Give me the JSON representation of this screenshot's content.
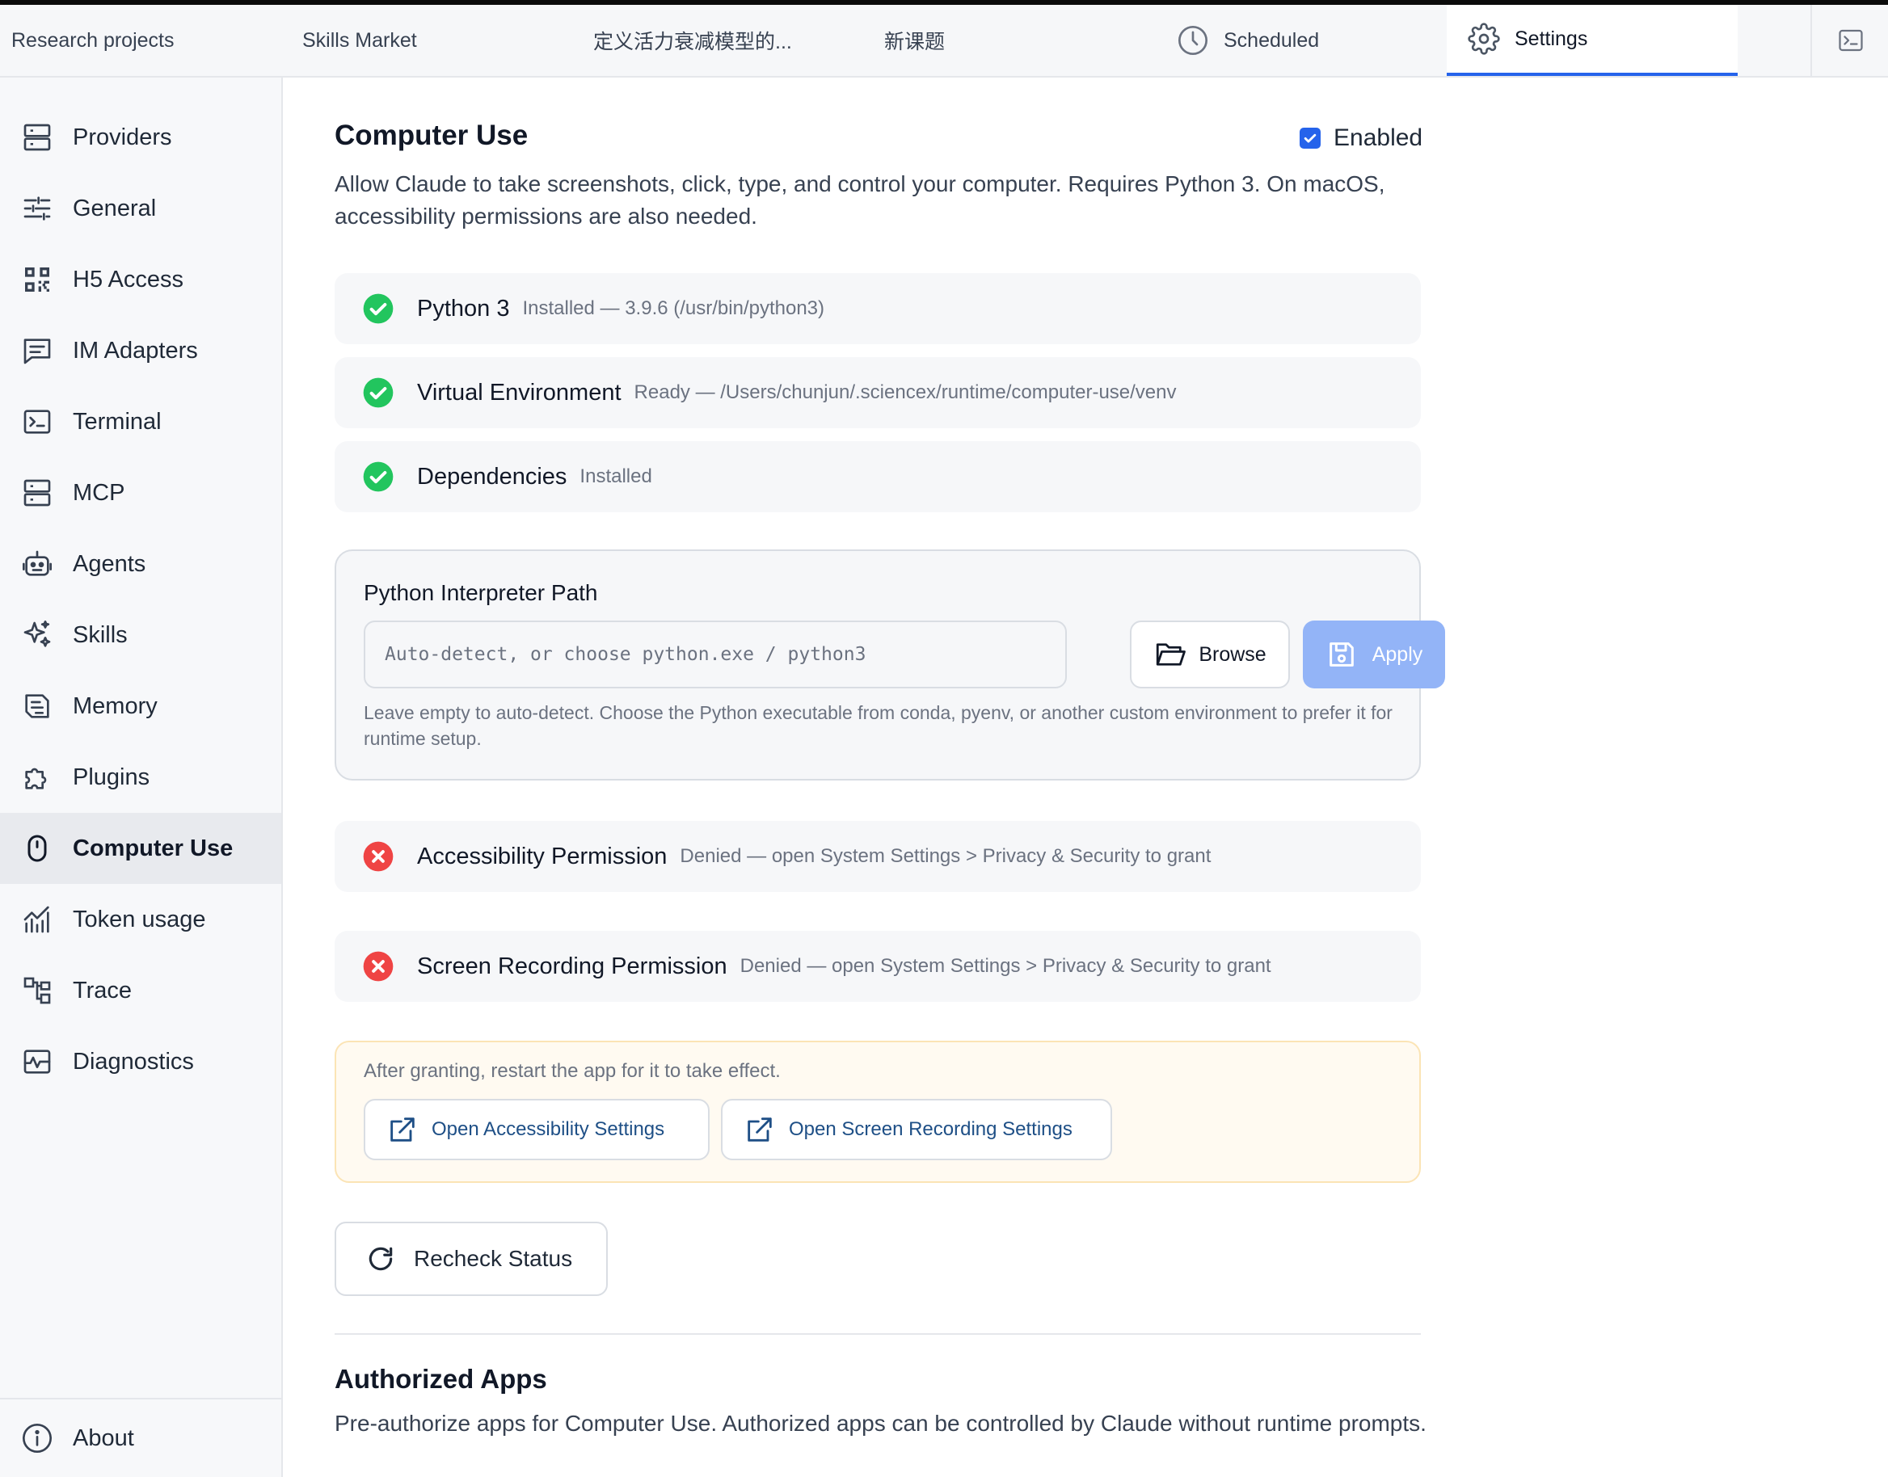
{
  "tabs": [
    {
      "label": "Research projects"
    },
    {
      "label": "Skills Market"
    },
    {
      "label": "定义活力衰减模型的..."
    },
    {
      "label": "新课题"
    },
    {
      "label": "Scheduled",
      "icon": "clock-icon"
    },
    {
      "label": "Settings",
      "icon": "gear-icon",
      "active": true
    }
  ],
  "sidebar": {
    "items": [
      {
        "label": "Providers",
        "icon": "server-icon"
      },
      {
        "label": "General",
        "icon": "sliders-icon"
      },
      {
        "label": "H5 Access",
        "icon": "qrcode-icon"
      },
      {
        "label": "IM Adapters",
        "icon": "message-icon"
      },
      {
        "label": "Terminal",
        "icon": "terminal-icon"
      },
      {
        "label": "MCP",
        "icon": "server-icon"
      },
      {
        "label": "Agents",
        "icon": "robot-icon"
      },
      {
        "label": "Skills",
        "icon": "sparkles-icon"
      },
      {
        "label": "Memory",
        "icon": "brain-icon"
      },
      {
        "label": "Plugins",
        "icon": "puzzle-icon"
      },
      {
        "label": "Computer Use",
        "icon": "mouse-icon",
        "active": true
      },
      {
        "label": "Token usage",
        "icon": "chart-icon"
      },
      {
        "label": "Trace",
        "icon": "hierarchy-icon"
      },
      {
        "label": "Diagnostics",
        "icon": "pulse-icon"
      }
    ],
    "about": {
      "label": "About",
      "icon": "info-icon"
    }
  },
  "computer_use": {
    "title": "Computer Use",
    "enabled_label": "Enabled",
    "enabled": true,
    "description": "Allow Claude to take screenshots, click, type, and control your computer. Requires Python 3. On macOS, accessibility permissions are also needed.",
    "checks": [
      {
        "name": "Python 3",
        "detail": "Installed — 3.9.6 (/usr/bin/python3)",
        "status": "ok"
      },
      {
        "name": "Virtual Environment",
        "detail": "Ready — /Users/chunjun/.sciencex/runtime/computer-use/venv",
        "status": "ok"
      },
      {
        "name": "Dependencies",
        "detail": "Installed",
        "status": "ok"
      }
    ],
    "interpreter": {
      "title": "Python Interpreter Path",
      "placeholder": "Auto-detect, or choose python.exe / python3",
      "value": "",
      "browse_label": "Browse",
      "apply_label": "Apply",
      "help": "Leave empty to auto-detect. Choose the Python executable from conda, pyenv, or another custom environment to prefer it for runtime setup."
    },
    "permissions": [
      {
        "name": "Accessibility Permission",
        "detail": "Denied — open System Settings > Privacy & Security to grant",
        "status": "denied"
      },
      {
        "name": "Screen Recording Permission",
        "detail": "Denied — open System Settings > Privacy & Security to grant",
        "status": "denied"
      }
    ],
    "notice": {
      "text": "After granting, restart the app for it to take effect.",
      "open_accessibility": "Open Accessibility Settings",
      "open_screen_recording": "Open Screen Recording Settings"
    },
    "recheck_label": "Recheck Status"
  },
  "authorized_apps": {
    "title": "Authorized Apps",
    "description": "Pre-authorize apps for Computer Use. Authorized apps can be controlled by Claude without runtime prompts."
  },
  "colors": {
    "accent": "#2563eb",
    "success": "#22c55e",
    "danger": "#ef4444",
    "apply_disabled": "#93b4f7",
    "link": "#1e4f86"
  }
}
